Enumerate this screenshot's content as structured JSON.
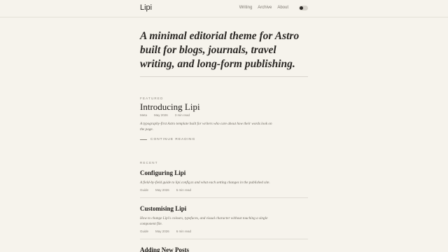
{
  "header": {
    "brand": "Lipi",
    "nav": [
      "Writing",
      "Archive",
      "About"
    ]
  },
  "hero": {
    "line1": "A minimal editorial theme for Astro",
    "line2": "built for blogs, journals, travel",
    "line3": "writing, and long-form publishing."
  },
  "featured": {
    "eyebrow": "FEATURED",
    "title": "Introducing Lipi",
    "meta": [
      "Meta",
      "May 2026",
      "3 min read"
    ],
    "excerpt_line1": "A typography-first Astro template built for writers who care about how their words look on",
    "excerpt_line2": "the page.",
    "continue_label": "CONTINUE READING"
  },
  "recent": {
    "eyebrow": "RECENT",
    "posts": [
      {
        "title": "Configuring Lipi",
        "excerpt": "A field-by-field guide to lipi.config.ts and what each setting changes in the published site.",
        "excerpt_line2": "",
        "meta": [
          "Guide",
          "May 2026",
          "5 min read"
        ]
      },
      {
        "title": "Customising Lipi",
        "excerpt": "How to change Lipi's colours, typefaces, and visual character without touching a single",
        "excerpt_line2": "component file.",
        "meta": [
          "Guide",
          "May 2026",
          "6 min read"
        ]
      },
      {
        "title": "Adding New Posts"
      }
    ]
  },
  "theme_toggle": {
    "state": "light"
  },
  "colors": {
    "background": "#f6f3ec",
    "text": "#2a2724",
    "muted": "#8a857d",
    "rule": "#d9d5cd"
  }
}
